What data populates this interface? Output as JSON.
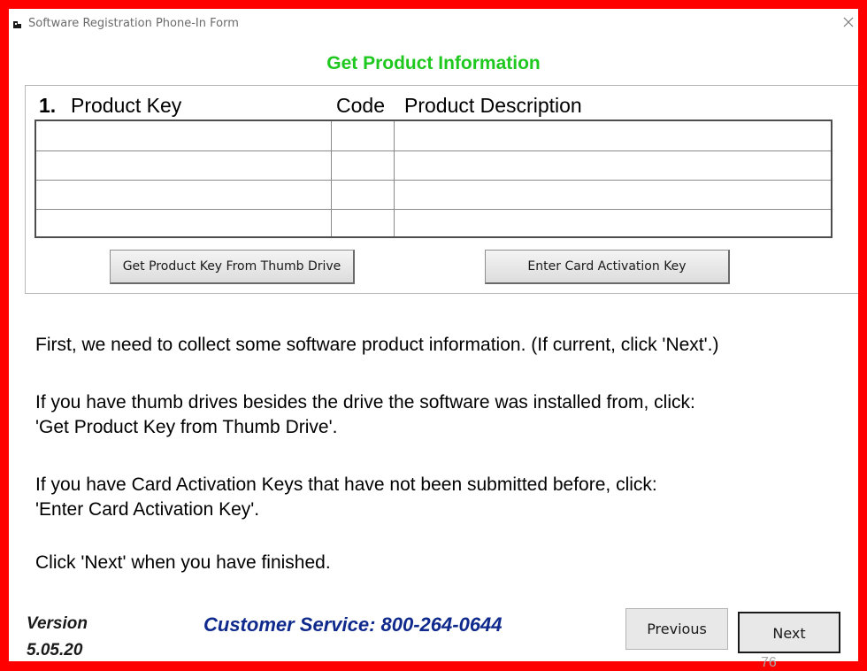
{
  "window": {
    "title": "Software Registration Phone-In Form"
  },
  "form": {
    "heading": "Get Product Information",
    "step_number": "1.",
    "columns": {
      "product_key": "Product Key",
      "code": "Code",
      "description": "Product Description"
    },
    "rows": [
      {
        "product_key": "",
        "code": "",
        "description": ""
      },
      {
        "product_key": "",
        "code": "",
        "description": ""
      },
      {
        "product_key": "",
        "code": "",
        "description": ""
      },
      {
        "product_key": "",
        "code": "",
        "description": ""
      }
    ],
    "buttons": {
      "thumb_drive": "Get Product Key From Thumb Drive",
      "card_activation": "Enter Card Activation Key"
    }
  },
  "instructions": {
    "line1": "First, we need to collect some software product information.  (If current, click 'Next'.)",
    "line2a": "If you have thumb drives besides the drive the software was installed from, click:",
    "line2b": "'Get Product Key from Thumb Drive'.",
    "line3a": "If you have Card Activation Keys that have not been submitted before, click:",
    "line3b": "'Enter Card Activation Key'.",
    "line4": "Click 'Next' when you have finished."
  },
  "footer": {
    "version_label": "Version",
    "version_number": "5.05.20",
    "customer_service": "Customer Service: 800-264-0644",
    "previous": "Previous",
    "next": "Next",
    "page_number": "76"
  },
  "colors": {
    "frame": "#ff0000",
    "heading": "#1ec81e",
    "service": "#0f2a8c"
  }
}
